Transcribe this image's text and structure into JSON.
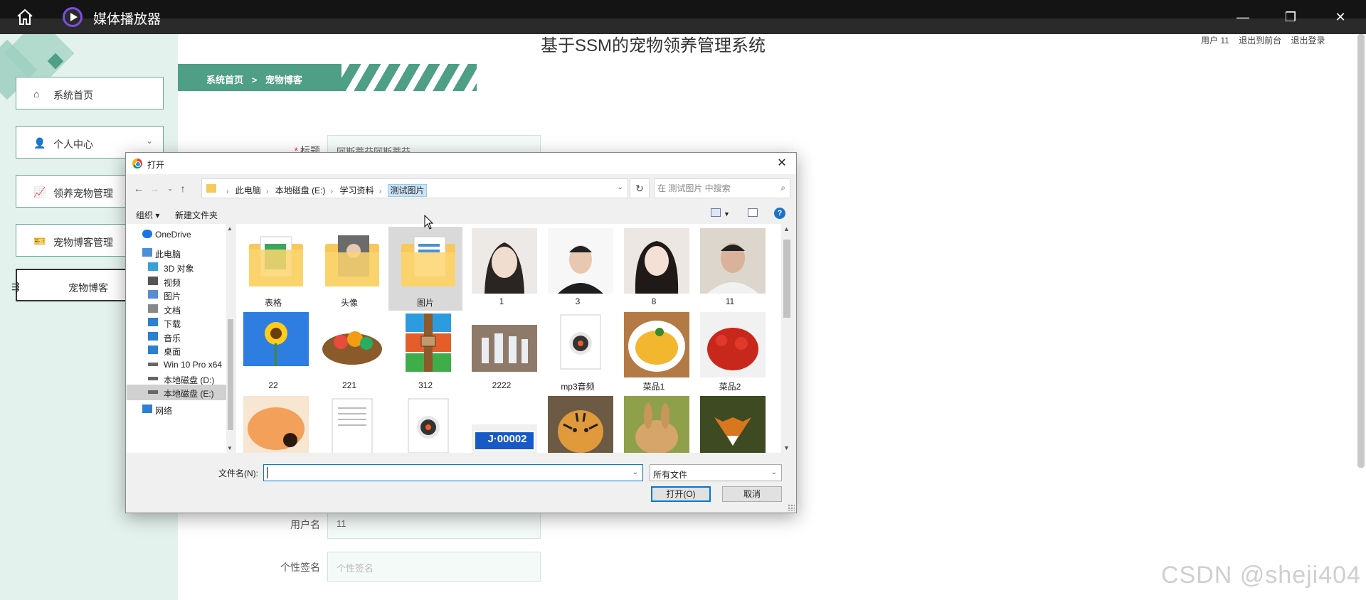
{
  "player": {
    "title": "媒体播放器"
  },
  "page": {
    "system_title": "基于SSM的宠物领养管理系统",
    "header_links": [
      "用户 11",
      "退出到前台",
      "退出登录"
    ],
    "breadcrumb": {
      "home": "系统首页",
      "sep": ">",
      "current": "宠物博客"
    },
    "sidebar": [
      {
        "label": "系统首页",
        "icon": "home-icon"
      },
      {
        "label": "个人中心",
        "icon": "person-icon"
      },
      {
        "label": "领养宠物管理",
        "icon": "chart-icon"
      },
      {
        "label": "宠物博客管理",
        "icon": "ticket-icon"
      },
      {
        "label": "宠物博客",
        "icon": "drag-handle-icon"
      }
    ],
    "form": {
      "title_label": "标题",
      "title_value": "阿斯蒂芬阿斯蒂芬",
      "username_label": "用户名",
      "username_value": "11",
      "signature_label": "个性签名",
      "signature_placeholder": "个性签名"
    },
    "watermark": "CSDN @sheji404"
  },
  "dialog": {
    "title": "打开",
    "path": [
      "此电脑",
      "本地磁盘 (E:)",
      "学习资料",
      "测试图片"
    ],
    "search_placeholder": "在 测试图片 中搜索",
    "toolbar": {
      "organize": "组织 ▾",
      "new_folder": "新建文件夹"
    },
    "nav_items": [
      {
        "label": "OneDrive",
        "icon": "cloud-icon"
      },
      {
        "label": "此电脑",
        "icon": "computer-icon"
      },
      {
        "label": "3D 对象",
        "icon": "cube-icon"
      },
      {
        "label": "视频",
        "icon": "video-icon"
      },
      {
        "label": "图片",
        "icon": "picture-icon"
      },
      {
        "label": "文档",
        "icon": "document-icon"
      },
      {
        "label": "下载",
        "icon": "download-icon"
      },
      {
        "label": "音乐",
        "icon": "music-icon"
      },
      {
        "label": "桌面",
        "icon": "desktop-icon"
      },
      {
        "label": "Win 10 Pro x64",
        "icon": "drive-icon"
      },
      {
        "label": "本地磁盘 (D:)",
        "icon": "drive-icon"
      },
      {
        "label": "本地磁盘 (E:)",
        "icon": "drive-icon"
      },
      {
        "label": "网络",
        "icon": "network-icon"
      }
    ],
    "files": [
      {
        "name": "表格",
        "kind": "folder-spreadsheet"
      },
      {
        "name": "头像",
        "kind": "folder-portrait"
      },
      {
        "name": "图片",
        "kind": "folder-doc"
      },
      {
        "name": "1",
        "kind": "photo-woman"
      },
      {
        "name": "3",
        "kind": "photo-man"
      },
      {
        "name": "8",
        "kind": "photo-woman2"
      },
      {
        "name": "11",
        "kind": "photo-man2"
      },
      {
        "name": "22",
        "kind": "photo-sunflower"
      },
      {
        "name": "221",
        "kind": "photo-fruit"
      },
      {
        "name": "312",
        "kind": "archive"
      },
      {
        "name": "2222",
        "kind": "photo-bottles"
      },
      {
        "name": "mp3音频",
        "kind": "audio"
      },
      {
        "name": "菜品1",
        "kind": "photo-dish1"
      },
      {
        "name": "菜品2",
        "kind": "photo-dish2"
      },
      {
        "name": "",
        "kind": "photo-shrimp"
      },
      {
        "name": "",
        "kind": "text-file"
      },
      {
        "name": "",
        "kind": "audio"
      },
      {
        "name": "",
        "kind": "photo-plate"
      },
      {
        "name": "",
        "kind": "photo-tiger"
      },
      {
        "name": "",
        "kind": "photo-rabbit"
      },
      {
        "name": "",
        "kind": "photo-fox"
      }
    ],
    "plate_text": "J·00002",
    "filename_label": "文件名(N):",
    "filename_value": "",
    "filter_value": "所有文件",
    "open_button": "打开(O)",
    "cancel_button": "取消"
  }
}
